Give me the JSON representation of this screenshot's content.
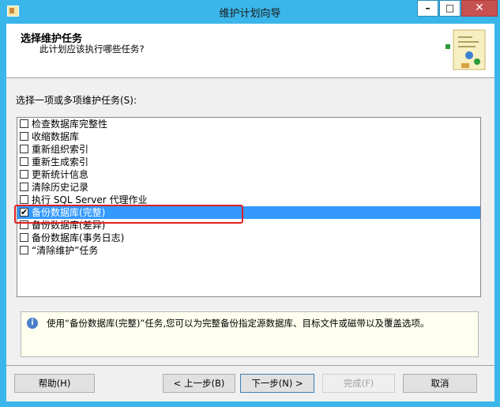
{
  "window": {
    "title": "维护计划向导"
  },
  "header": {
    "title": "选择维护任务",
    "subtitle": "此计划应该执行哪些任务?"
  },
  "section_label": "选择一项或多项维护任务(S):",
  "tasks": [
    {
      "label": "检查数据库完整性",
      "checked": false
    },
    {
      "label": "收缩数据库",
      "checked": false
    },
    {
      "label": "重新组织索引",
      "checked": false
    },
    {
      "label": "重新生成索引",
      "checked": false
    },
    {
      "label": "更新统计信息",
      "checked": false
    },
    {
      "label": "清除历史记录",
      "checked": false
    },
    {
      "label": "执行 SQL Server 代理作业",
      "checked": false
    },
    {
      "label": "备份数据库(完整)",
      "checked": true,
      "selected": true
    },
    {
      "label": "备份数据库(差异)",
      "checked": false
    },
    {
      "label": "备份数据库(事务日志)",
      "checked": false
    },
    {
      "label": "“清除维护”任务",
      "checked": false
    }
  ],
  "description": "使用“备份数据库(完整)”任务,您可以为完整备份指定源数据库、目标文件或磁带以及覆盖选项。",
  "buttons": {
    "help": "帮助(H)",
    "back": "< 上一步(B)",
    "next": "下一步(N) >",
    "finish": "完成(F)",
    "cancel": "取消"
  },
  "colors": {
    "titlebar": "#3bb6ea",
    "selection": "#3399ff",
    "highlight": "#e02020"
  },
  "icons": {
    "app": "wizard-app-icon",
    "info": "info-icon",
    "close": "close-icon"
  }
}
